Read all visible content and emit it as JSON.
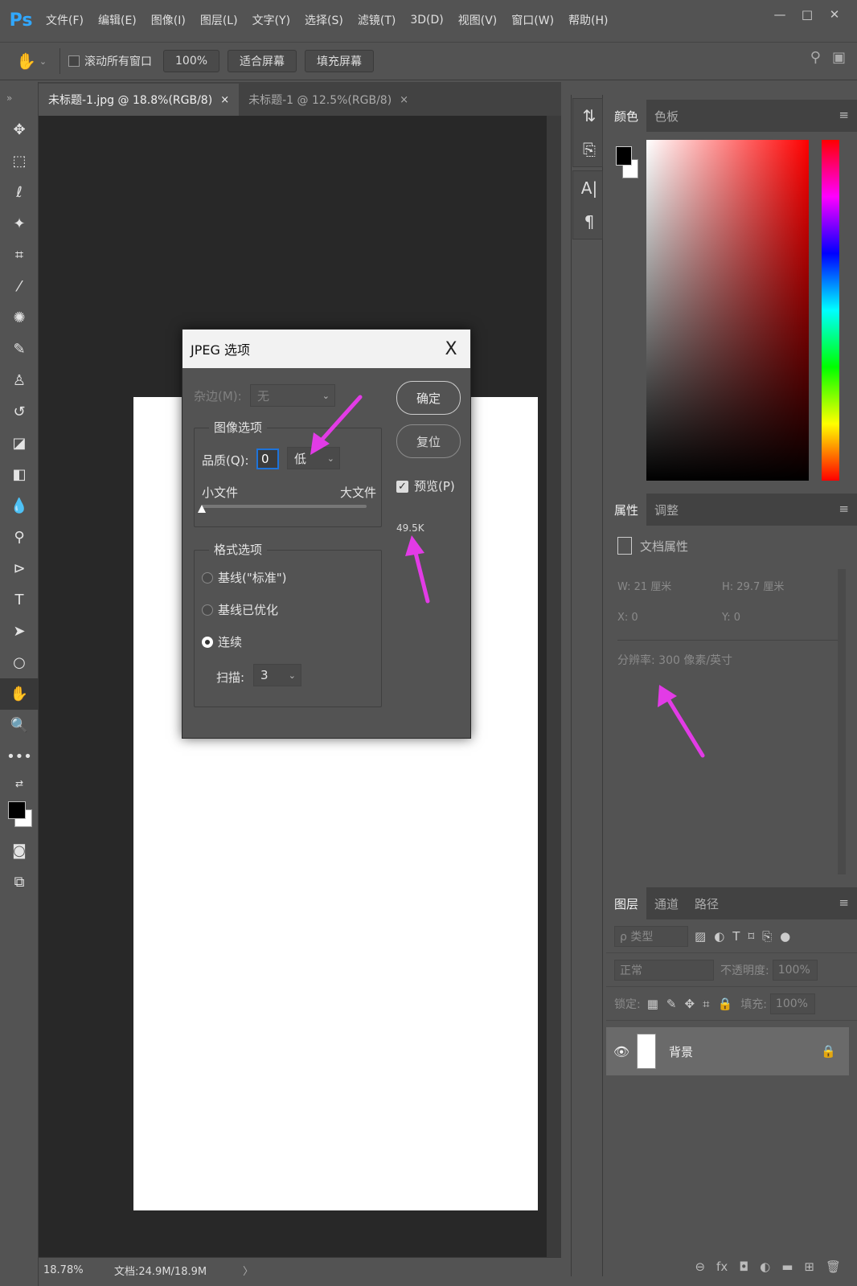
{
  "app": {
    "logo": "Ps",
    "window_controls": [
      "—",
      "□",
      "✕"
    ]
  },
  "menu": [
    "文件(F)",
    "编辑(E)",
    "图像(I)",
    "图层(L)",
    "文字(Y)",
    "选择(S)",
    "滤镜(T)",
    "3D(D)",
    "视图(V)",
    "窗口(W)",
    "帮助(H)"
  ],
  "options": {
    "scroll_all_label": "滚动所有窗口",
    "zoom_btn": "100%",
    "fit_btn": "适合屏幕",
    "fill_btn": "填充屏幕"
  },
  "tabs": [
    {
      "label": "未标题-1.jpg @ 18.8%(RGB/8)",
      "close": "×"
    },
    {
      "label": "未标题-1 @ 12.5%(RGB/8)",
      "close": "×"
    }
  ],
  "status": {
    "zoom": "18.78%",
    "doc": "文档:24.9M/18.9M",
    "arrow": "〉"
  },
  "color_panel": {
    "tabs": [
      "颜色",
      "色板"
    ]
  },
  "properties_panel": {
    "tabs": [
      "属性",
      "调整"
    ],
    "header": "文档属性",
    "w": "W:  21 厘米",
    "h": "H:  29.7 厘米",
    "x": "X:  0",
    "y": "Y:  0",
    "resolution": "分辨率: 300 像素/英寸"
  },
  "layers_panel": {
    "tabs": [
      "图层",
      "通道",
      "路径"
    ],
    "filter_label": "ρ 类型",
    "blend_mode": "正常",
    "opacity_label": "不透明度:",
    "opacity_value": "100%",
    "lock_label": "锁定:",
    "fill_label": "填充:",
    "fill_value": "100%",
    "layer_name": "背景"
  },
  "dialog": {
    "title": "JPEG 选项",
    "close": "X",
    "matte_label": "杂边(M):",
    "matte_value": "无",
    "image_options_title": "图像选项",
    "quality_label": "品质(Q):",
    "quality_value": "0",
    "quality_level": "低",
    "small_file": "小文件",
    "large_file": "大文件",
    "format_options_title": "格式选项",
    "radio_baseline_std": "基线(\"标准\")",
    "radio_baseline_opt": "基线已优化",
    "radio_progressive": "连续",
    "scans_label": "扫描:",
    "scans_value": "3",
    "ok": "确定",
    "reset": "复位",
    "preview_label": "预览(P)",
    "file_size": "49.5K",
    "quality_slider": 0
  },
  "colors": {
    "annotation": "#e23be6",
    "foreground": "#000000",
    "background": "#ffffff"
  }
}
